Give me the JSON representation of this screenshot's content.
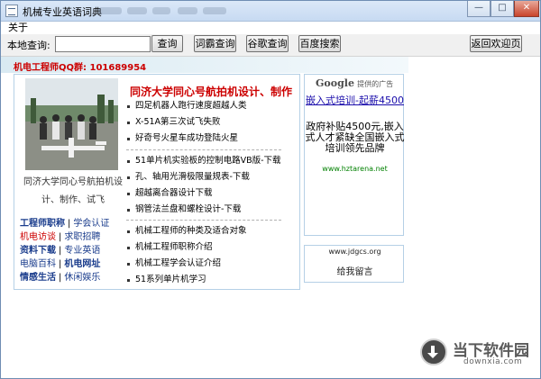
{
  "window": {
    "title": "机械专业英语词典",
    "close_label": "✕",
    "minimize_label": "—",
    "maximize_label": "□"
  },
  "menu": {
    "items": [
      "关于"
    ]
  },
  "toolbar": {
    "query_label": "本地查询:",
    "search_value": "",
    "search_placeholder": "",
    "buttons": {
      "query": "查询",
      "iciba": "词霸查询",
      "google": "谷歌查询",
      "baidu": "百度搜索",
      "home": "返回欢迎页"
    }
  },
  "qq_line": "机电工程师QQ群: 101689954",
  "photo_caption": "同济大学同心号航拍机设计、制作、试飞",
  "section_title": "同济大学同心号航拍机设计、制作",
  "news_list_1": [
    "四足机器人跑行速度超越人类",
    "X-51A第三次试飞失败",
    "好奇号火星车成功登陆火星"
  ],
  "news_list_2": [
    "51单片机实验板的控制电路VB版-下载",
    "孔、轴用光滑极限量规表-下载",
    "超越离合器设计下载",
    "钢管法兰盘和螺栓设计-下载"
  ],
  "news_list_3": [
    "机械工程师的种类及适合对象",
    "机械工程师职称介绍",
    "机械工程学会认证介绍",
    "51系列单片机学习"
  ],
  "nav_links": {
    "row1": [
      "工程师职称",
      "学会认证"
    ],
    "row2": [
      "机电访谈",
      "求职招聘"
    ],
    "row3": [
      "资料下载",
      "专业英语"
    ],
    "row4": [
      "电脑百科",
      "机电网址"
    ],
    "row5": [
      "情感生活",
      "休闲娱乐"
    ]
  },
  "ad": {
    "brand": "Google",
    "provided": "提供的广告",
    "link": "嵌入式培训-起薪4500",
    "text": "政府补贴4500元,嵌入式人才紧缺全国嵌入式培训领先品牌",
    "url": "www.hztarena.net"
  },
  "guestbook": {
    "url": "www.jdgcs.org",
    "message": "给我留言"
  },
  "watermark": {
    "title": "当下软件园",
    "url": "downxia.com"
  },
  "colors": {
    "accent_red": "#cc0000",
    "link_blue": "#1a0dab",
    "link_green": "#008000",
    "panel_border": "#b5d0e6"
  }
}
